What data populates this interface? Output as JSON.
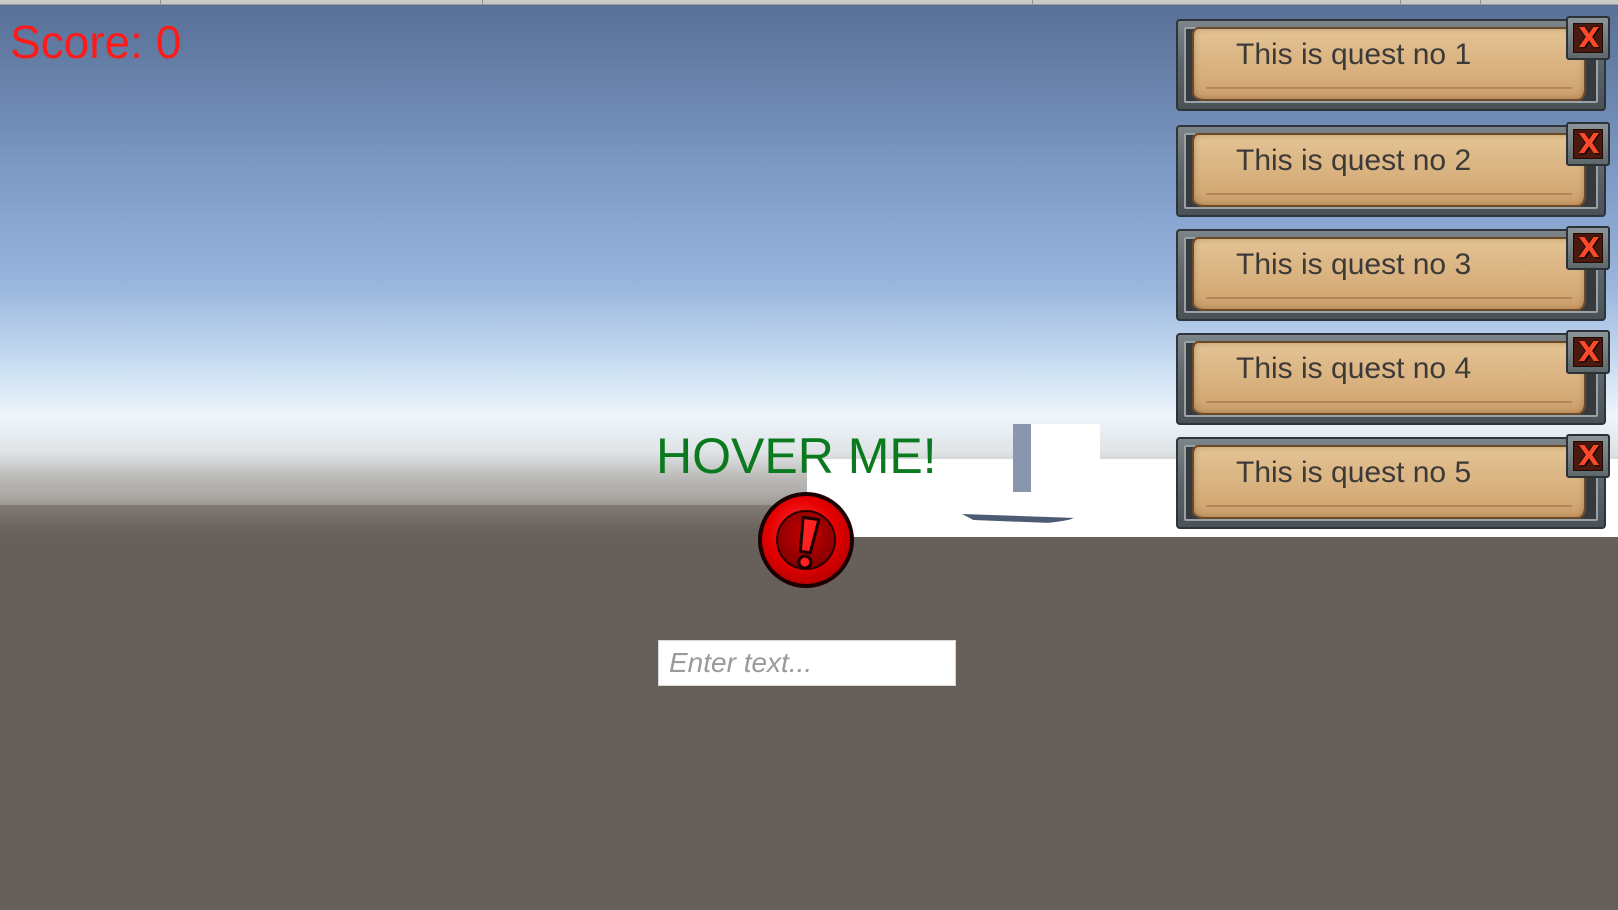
{
  "hud": {
    "score_text": "Score: 0",
    "hover_label": "HOVER ME!"
  },
  "input": {
    "placeholder": "Enter text...",
    "value": ""
  },
  "alert_button": {
    "icon": "exclamation-icon",
    "glyph": "!"
  },
  "quests": [
    {
      "label": "This is quest no 1",
      "close_glyph": "X"
    },
    {
      "label": "This is quest no 2",
      "close_glyph": "X"
    },
    {
      "label": "This is quest no 3",
      "close_glyph": "X"
    },
    {
      "label": "This is quest no 4",
      "close_glyph": "X"
    },
    {
      "label": "This is quest no 5",
      "close_glyph": "X"
    }
  ],
  "colors": {
    "score": "#ff1a1a",
    "hover_label": "#0b7a1e",
    "parchment": "#ddb887",
    "close_glyph": "#ff4a2a"
  }
}
